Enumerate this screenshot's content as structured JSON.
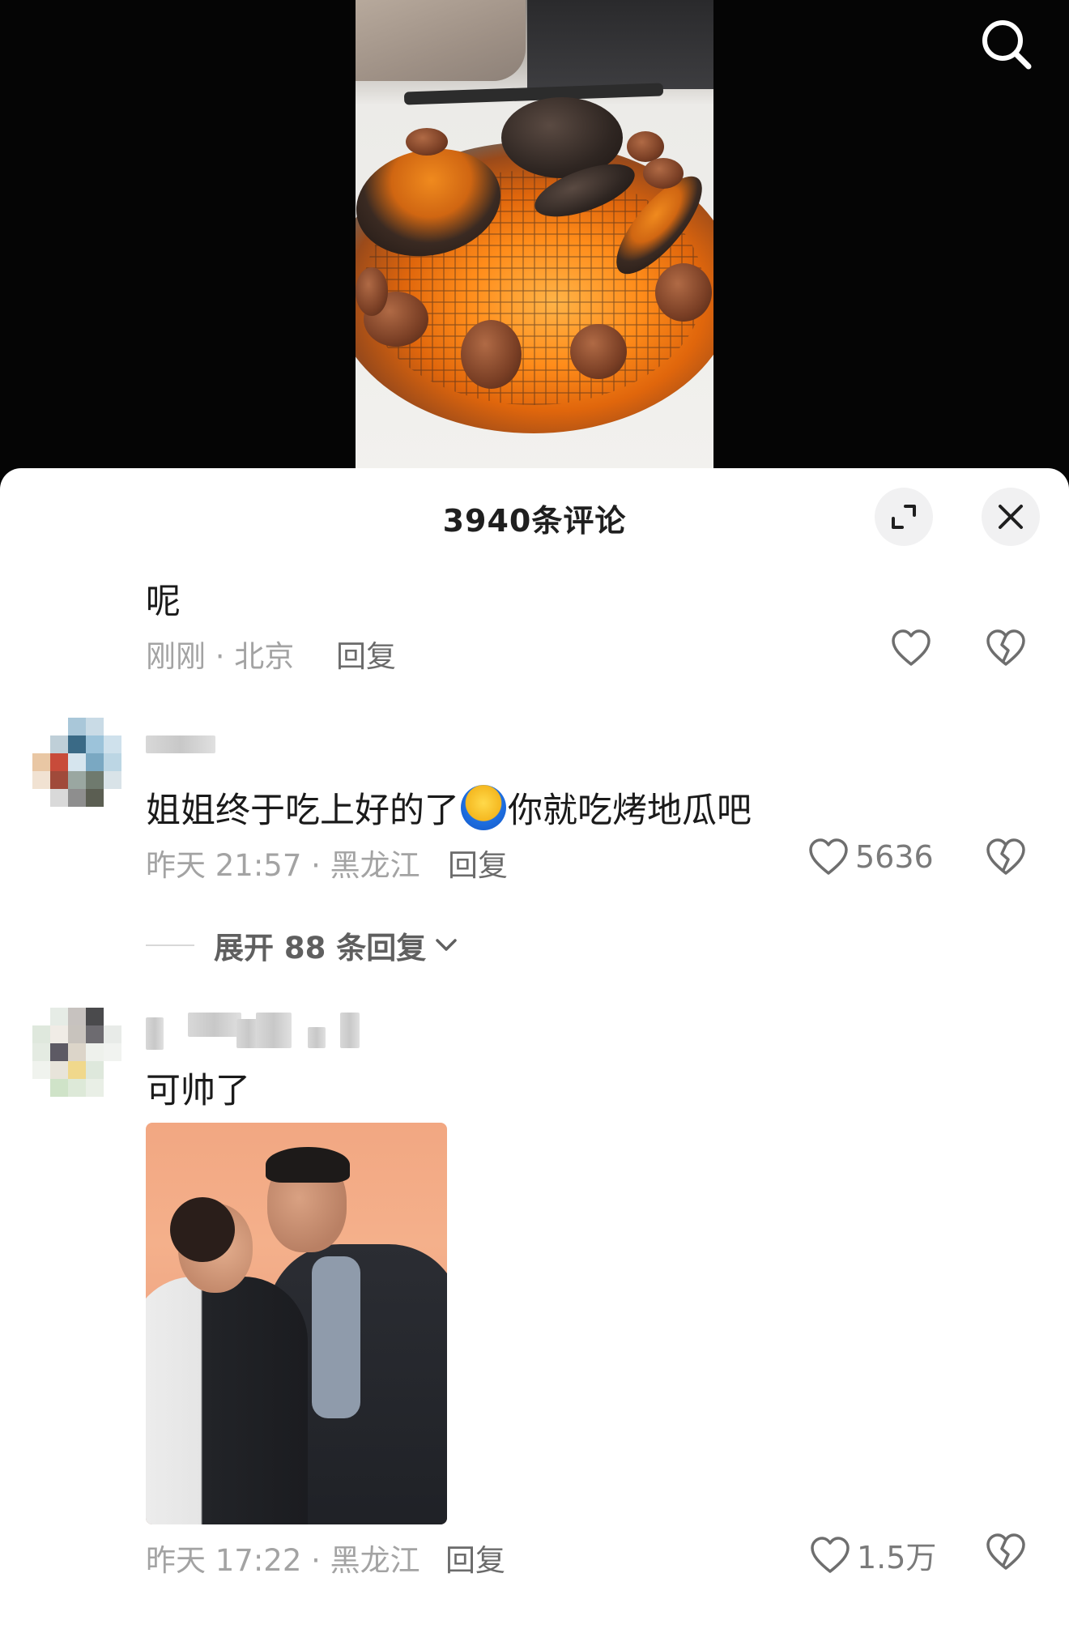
{
  "header": {
    "title": "3940条评论"
  },
  "icons": {
    "search": "search-icon",
    "expand": "expand-icon",
    "close": "close-icon",
    "like": "heart-icon",
    "dislike": "broken-heart-icon",
    "chevron": "chevron-down-icon"
  },
  "comments": [
    {
      "text": "呢",
      "meta": "刚刚 · 北京",
      "reply_label": "回复",
      "likes": ""
    },
    {
      "text_before_emoji": "姐姐终于吃上好的了",
      "text_after_emoji": "你就吃烤地瓜吧",
      "meta": "昨天 21:57 · 黑龙江",
      "reply_label": "回复",
      "likes": "5636",
      "expand_label": "展开 88 条回复"
    },
    {
      "text": "可帅了",
      "meta": "昨天 17:22 · 黑龙江",
      "reply_label": "回复",
      "likes": "1.5万"
    }
  ],
  "colors": {
    "sheet_bg": "#ffffff",
    "text_primary": "#1a1a1a",
    "text_meta": "#a3a3a3",
    "icon_stroke": "#6e6e6e"
  }
}
